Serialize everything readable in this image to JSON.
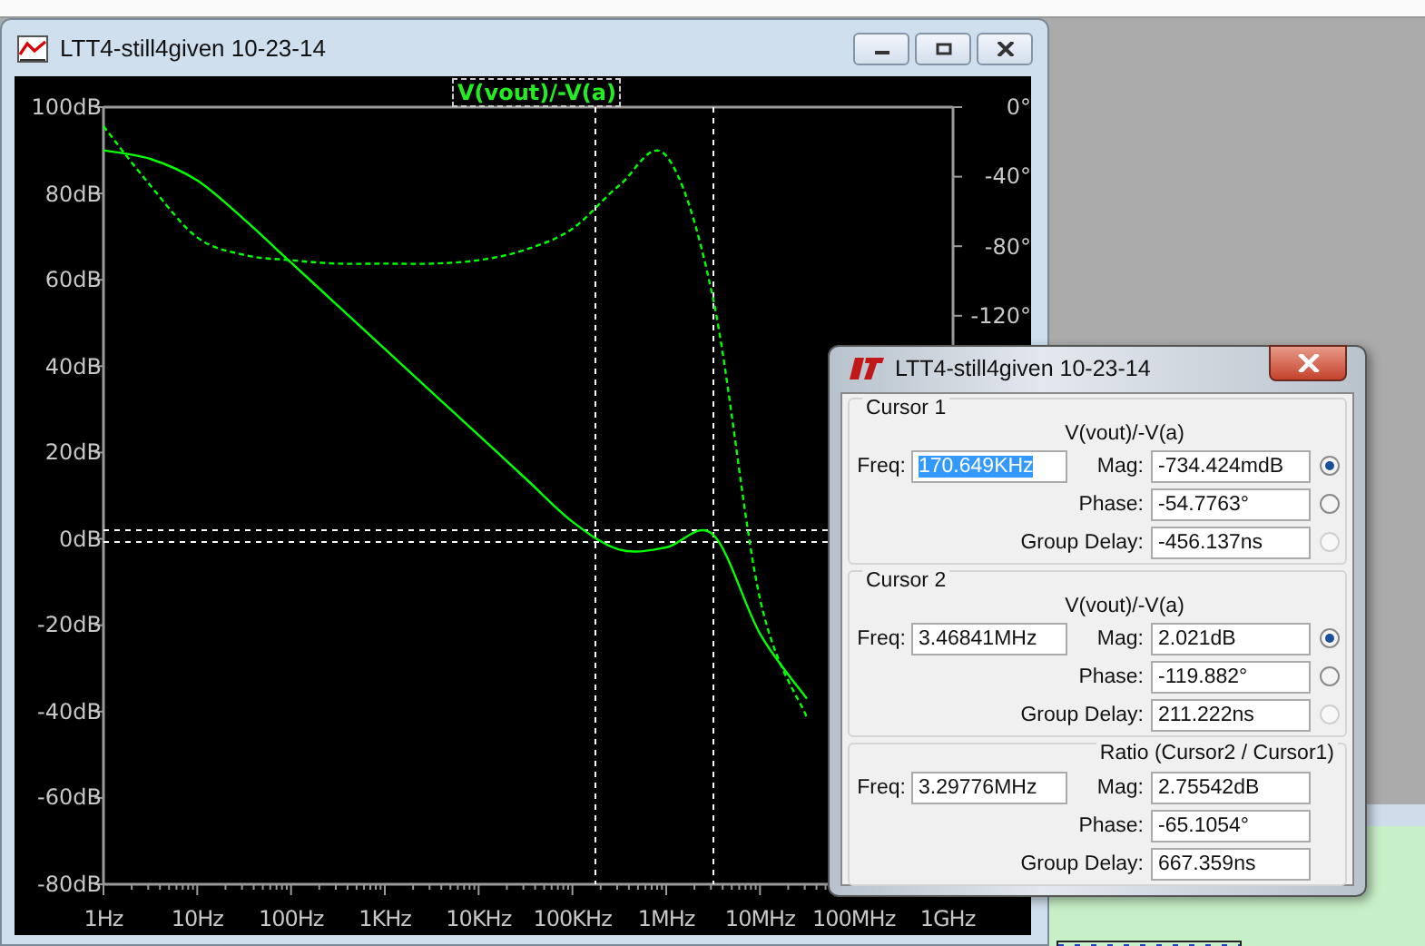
{
  "plot_window": {
    "title": "LTT4-still4given 10-23-14",
    "trace_label": "V(vout)/-V(a)",
    "magnitude": {
      "chart_data": {
        "type": "line",
        "categories": [
          "1Hz",
          null,
          "10Hz",
          null,
          "100Hz",
          null,
          "1KHz",
          null,
          "10KHz",
          null,
          "100KHz",
          null,
          "1MHz",
          null,
          "10MHz",
          null,
          "100MHz",
          null,
          "1GHz"
        ],
        "ylim": [
          -80,
          100
        ],
        "yticks": [
          {
            "value": 100,
            "label": "100dB"
          },
          {
            "value": 80,
            "label": "80dB"
          },
          {
            "value": 60,
            "label": "60dB"
          },
          {
            "value": 40,
            "label": "40dB"
          },
          {
            "value": 20,
            "label": "20dB"
          },
          {
            "value": 0,
            "label": "0dB"
          },
          {
            "value": -20,
            "label": "-20dB"
          },
          {
            "value": -40,
            "label": "-40dB"
          },
          {
            "value": -60,
            "label": "-60dB"
          },
          {
            "value": -80,
            "label": "-80dB"
          }
        ],
        "series": [
          {
            "color": "#00ff00",
            "values": [
              90,
              88,
              83,
              74,
              64,
              54,
              44,
              34,
              24,
              14,
              4,
              -2.5,
              -2,
              1,
              -22,
              -37,
              null,
              null,
              null
            ]
          }
        ],
        "ref_lines": [
          {
            "axis": "y",
            "value": 2
          },
          {
            "axis": "y",
            "value": -0.7
          }
        ]
      }
    },
    "phase": {
      "chart_data": {
        "type": "line",
        "ylim": [
          -447,
          0
        ],
        "yticks": [
          {
            "value": 0,
            "label": "0°"
          },
          {
            "value": -40,
            "label": "-40°"
          },
          {
            "value": -80,
            "label": "-80°"
          },
          {
            "value": -120,
            "label": "-120°"
          }
        ],
        "series": [
          {
            "color": "#00ff00",
            "line_style": "dashed",
            "values": [
              -11,
              -45,
              -75,
              -85,
              -88,
              -90,
              -90,
              -90,
              -88,
              -82,
              -70,
              -45,
              -28,
              -110,
              -283,
              -351,
              null,
              null,
              null
            ]
          }
        ]
      }
    }
  },
  "dialog": {
    "title": "LTT4-still4given 10-23-14",
    "sections": [
      {
        "kind": "cursor",
        "legend": "Cursor 1",
        "trace": "V(vout)/-V(a)",
        "freq_label": "Freq:",
        "freq": "170.649KHz",
        "highlighted": true,
        "rows": [
          {
            "label": "Mag:",
            "value": "-734.424mdB",
            "selected": true,
            "disabled": false
          },
          {
            "label": "Phase:",
            "value": "-54.7763°",
            "selected": false,
            "disabled": false
          },
          {
            "label": "Group Delay:",
            "value": "-456.137ns",
            "selected": false,
            "disabled": true
          }
        ]
      },
      {
        "kind": "cursor",
        "legend": "Cursor 2",
        "trace": "V(vout)/-V(a)",
        "freq_label": "Freq:",
        "freq": "3.46841MHz",
        "highlighted": false,
        "rows": [
          {
            "label": "Mag:",
            "value": "2.021dB",
            "selected": true,
            "disabled": false
          },
          {
            "label": "Phase:",
            "value": "-119.882°",
            "selected": false,
            "disabled": false
          },
          {
            "label": "Group Delay:",
            "value": "211.222ns",
            "selected": false,
            "disabled": true
          }
        ]
      },
      {
        "kind": "ratio",
        "legend": "Ratio (Cursor2 / Cursor1)",
        "freq_label": "Freq:",
        "freq": "3.29776MHz",
        "highlighted": false,
        "rows": [
          {
            "label": "Mag:",
            "value": "2.75542dB"
          },
          {
            "label": "Phase:",
            "value": "-65.1054°"
          },
          {
            "label": "Group Delay:",
            "value": "667.359ns"
          }
        ]
      }
    ]
  }
}
